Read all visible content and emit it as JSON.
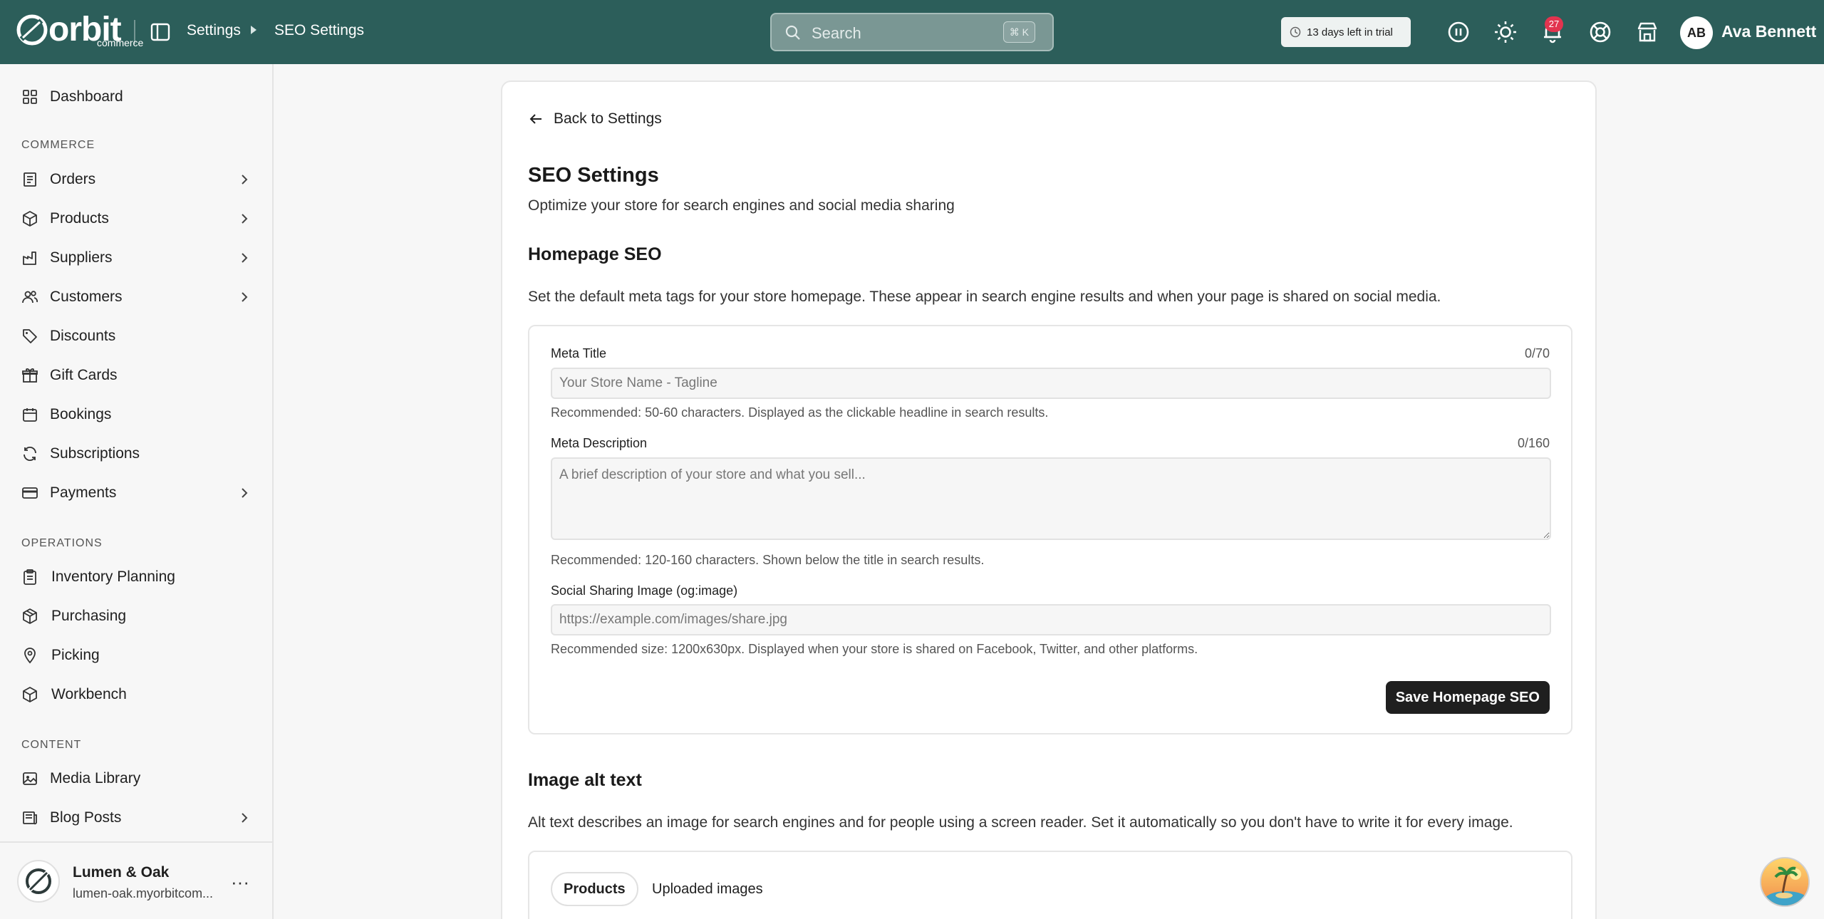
{
  "topbar": {
    "logo_text": "orbit",
    "logo_sub": "commerce",
    "breadcrumb": [
      "Settings",
      "SEO Settings"
    ],
    "search_placeholder": "Search",
    "search_shortcut": "⌘ K",
    "trial_text": "13 days left in trial",
    "notifications_count": "27",
    "user_initials": "AB",
    "user_name": "Ava Bennett"
  },
  "sidebar": {
    "dashboard": "Dashboard",
    "commerce_heading": "COMMERCE",
    "commerce_items": [
      "Orders",
      "Products",
      "Suppliers",
      "Customers",
      "Discounts",
      "Gift Cards",
      "Bookings",
      "Subscriptions",
      "Payments"
    ],
    "operations_heading": "OPERATIONS",
    "operations_items": [
      "Inventory Planning",
      "Purchasing",
      "Picking",
      "Workbench"
    ],
    "content_heading": "CONTENT",
    "content_items": [
      "Media Library",
      "Blog Posts"
    ],
    "store_name": "Lumen & Oak",
    "store_url": "lumen-oak.myorbitcom...",
    "store_more": "···"
  },
  "main": {
    "back_label": "Back to Settings",
    "title": "SEO Settings",
    "subtitle": "Optimize your store for search engines and social media sharing",
    "homepage": {
      "heading": "Homepage SEO",
      "description": "Set the default meta tags for your store homepage. These appear in search engine results and when your page is shared on social media.",
      "meta_title_label": "Meta Title",
      "meta_title_counter": "0/70",
      "meta_title_placeholder": "Your Store Name - Tagline",
      "meta_title_help": "Recommended: 50-60 characters. Displayed as the clickable headline in search results.",
      "meta_desc_label": "Meta Description",
      "meta_desc_counter": "0/160",
      "meta_desc_placeholder": "A brief description of your store and what you sell...",
      "meta_desc_help": "Recommended: 120-160 characters. Shown below the title in search results.",
      "og_label": "Social Sharing Image (og:image)",
      "og_placeholder": "https://example.com/images/share.jpg",
      "og_help": "Recommended size: 1200x630px. Displayed when your store is shared on Facebook, Twitter, and other platforms.",
      "save_label": "Save Homepage SEO"
    },
    "alt_text": {
      "heading": "Image alt text",
      "description": "Alt text describes an image for search engines and for people using a screen reader. Set it automatically so you don't have to write it for every image.",
      "tabs": [
        "Products",
        "Uploaded images"
      ]
    }
  }
}
